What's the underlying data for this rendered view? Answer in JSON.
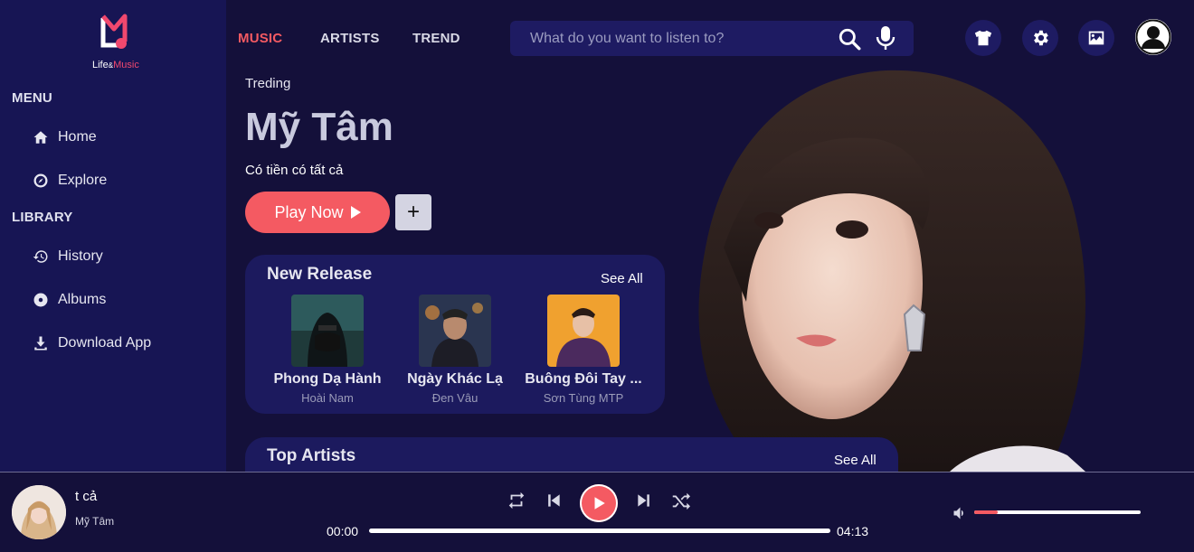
{
  "logo": {
    "text_a": "Life",
    "text_amp": "&",
    "text_b": "Music"
  },
  "sidebar": {
    "menu_title": "MENU",
    "menu_items": [
      {
        "label": "Home",
        "icon": "home-icon"
      },
      {
        "label": "Explore",
        "icon": "compass-icon"
      }
    ],
    "library_title": "LIBRARY",
    "library_items": [
      {
        "label": "History",
        "icon": "history-icon"
      },
      {
        "label": "Albums",
        "icon": "disc-icon"
      },
      {
        "label": "Download App",
        "icon": "download-icon"
      }
    ]
  },
  "topnav": {
    "tabs": [
      {
        "label": "MUSIC",
        "active": true
      },
      {
        "label": "ARTISTS",
        "active": false
      },
      {
        "label": "TREND",
        "active": false
      }
    ]
  },
  "search": {
    "placeholder": "What do you want to listen to?",
    "value": ""
  },
  "toolbar": {
    "buttons": [
      "shirt-icon",
      "gear-icon",
      "image-icon",
      "user-icon"
    ]
  },
  "hero": {
    "label": "Treding",
    "title": "Mỹ Tâm",
    "subtitle": "Có tiền có tất cả",
    "play_label": "Play Now",
    "add_label": "+"
  },
  "new_release": {
    "title": "New Release",
    "see_all": "See All",
    "items": [
      {
        "song": "Phong Dạ Hành",
        "artist": "Hoài Nam"
      },
      {
        "song": "Ngày Khác Lạ",
        "artist": "Đen Vâu"
      },
      {
        "song": "Buông Đôi Tay ...",
        "artist": "Sơn Tùng MTP"
      }
    ]
  },
  "top_artists": {
    "title": "Top Artists",
    "see_all": "See All"
  },
  "player": {
    "title": "t cả",
    "artist": "Mỹ Tâm",
    "current_time": "00:00",
    "total_time": "04:13",
    "progress": 0,
    "volume": 0.14
  },
  "colors": {
    "accent": "#f45a62",
    "background": "#14103a",
    "sidebar": "#171554",
    "card": "#1c1a5e"
  }
}
